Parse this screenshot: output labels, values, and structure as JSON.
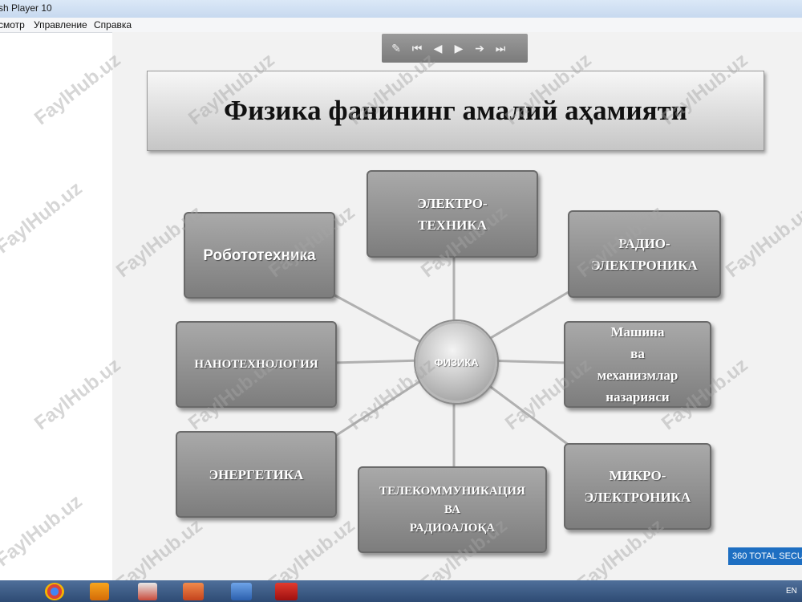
{
  "window": {
    "title": "sh Player 10"
  },
  "menu": [
    "смотр",
    "Управление",
    "Справка"
  ],
  "slide": {
    "title": "Физика фанининг амалий аҳамияти",
    "center": "ФИЗИКА",
    "nodes": {
      "robotics": "Робототехника",
      "electrotech": "ЭЛЕКТРО-\nТЕХНИКА",
      "radioelectronics": "РАДИО-\nЭЛЕКТРОНИКА",
      "nanotech": "НАНОТЕХНОЛОГИЯ",
      "machines": "Машина\nва\nмеханизмлар\nназарияси",
      "energy": "ЭНЕРГЕТИКА",
      "telecom": "ТЕЛЕКОММУНИКАЦИЯ\nВА\nРАДИОАЛОҚА",
      "microelectronics": "МИКРО-\nЭЛЕКТРОНИКА"
    }
  },
  "watermark": "FaylHub.uz",
  "badge": "360 TOTAL SECU",
  "taskbar": {
    "lang": "EN"
  },
  "icons": {
    "controls": [
      "pen-icon",
      "first-frame-icon",
      "prev-frame-icon",
      "play-icon",
      "next-frame-icon",
      "last-frame-icon"
    ],
    "taskbar": [
      "chrome-icon",
      "media-player-icon",
      "paint-icon",
      "powerpoint-icon",
      "word-icon",
      "flash-icon"
    ]
  },
  "colors": {
    "titlebar": "#c7d9ef",
    "taskbar": "#2e4b74",
    "box": "#8c8c8c",
    "badge": "#1e6fc2"
  }
}
